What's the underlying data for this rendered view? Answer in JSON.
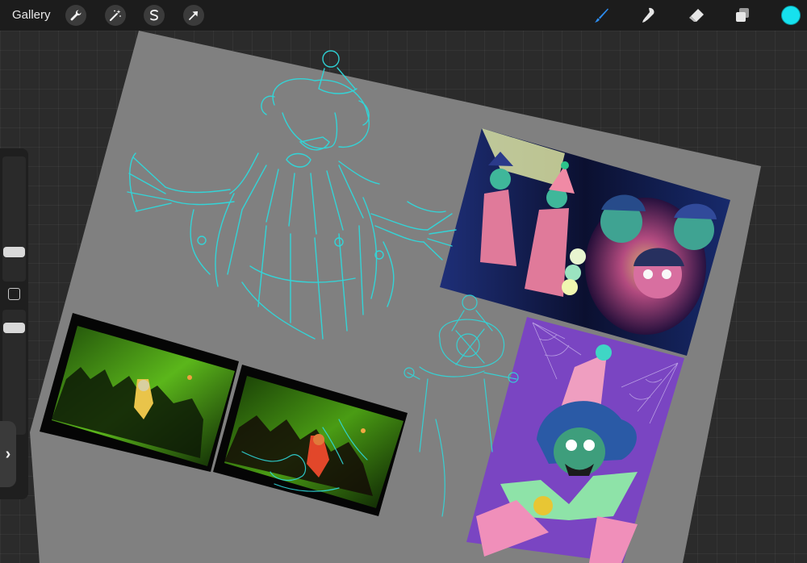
{
  "toolbar": {
    "gallery_label": "Gallery",
    "left_icons": [
      "wrench-icon",
      "magic-wand-icon",
      "selection-icon",
      "transform-arrow-icon"
    ],
    "right_tools": [
      "brush-icon",
      "smudge-icon",
      "eraser-icon",
      "layers-icon"
    ],
    "active_tool": "brush-icon",
    "current_color": "#16e1ee"
  },
  "sidebar": {
    "brush_size_level": 0.55,
    "opacity_level": 0.2
  },
  "colors": {
    "canvas_bg": "#808080",
    "sketch_line": "#2fd9dc",
    "workspace_bg": "#2b2b2b"
  }
}
